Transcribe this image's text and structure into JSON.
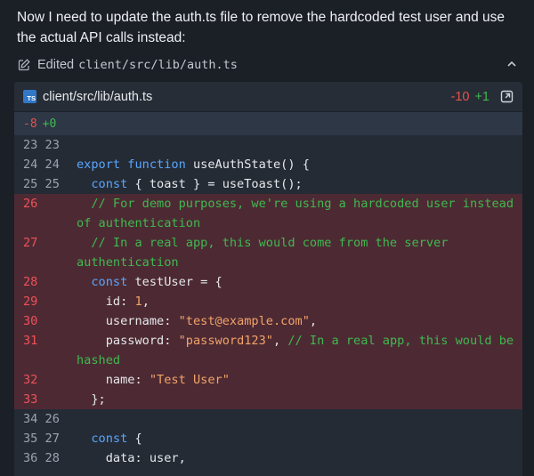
{
  "message": "Now I need to update the auth.ts file to remove the hardcoded test user and use the actual API calls instead:",
  "edited": {
    "label": "Edited",
    "path": "client/src/lib/auth.ts",
    "icon": "edit-icon",
    "collapse_icon": "chevron-up-icon"
  },
  "file": {
    "badge": "TS",
    "name": "client/src/lib/auth.ts",
    "removed": "-10",
    "added": "+1",
    "open_icon": "open-in-editor-icon"
  },
  "hunk": {
    "removed": "-8",
    "added": "+0"
  },
  "lines": [
    {
      "gutter": "23 23",
      "type": "context",
      "tokens": []
    },
    {
      "gutter": "24 24",
      "type": "context",
      "tokens": [
        {
          "t": "kw",
          "v": "export function "
        },
        {
          "t": "fn",
          "v": "useAuthState() {"
        }
      ]
    },
    {
      "gutter": "25 25",
      "type": "context",
      "tokens": [
        {
          "t": "fn",
          "v": "  "
        },
        {
          "t": "kw",
          "v": "const"
        },
        {
          "t": "fn",
          "v": " { toast } = useToast();"
        }
      ]
    },
    {
      "gutter": "26",
      "type": "del",
      "tokens": [
        {
          "t": "cm",
          "v": "  // For demo purposes, we're using a hardcoded user instead of authentication"
        }
      ]
    },
    {
      "gutter": "27",
      "type": "del",
      "tokens": [
        {
          "t": "cm",
          "v": "  // In a real app, this would come from the server authentication"
        }
      ]
    },
    {
      "gutter": "28",
      "type": "del",
      "tokens": [
        {
          "t": "fn",
          "v": "  "
        },
        {
          "t": "kw",
          "v": "const"
        },
        {
          "t": "fn",
          "v": " testUser = {"
        }
      ]
    },
    {
      "gutter": "29",
      "type": "del",
      "tokens": [
        {
          "t": "fn",
          "v": "    id: "
        },
        {
          "t": "num",
          "v": "1"
        },
        {
          "t": "fn",
          "v": ","
        }
      ]
    },
    {
      "gutter": "30",
      "type": "del",
      "tokens": [
        {
          "t": "fn",
          "v": "    username: "
        },
        {
          "t": "str",
          "v": "\"test@example.com\""
        },
        {
          "t": "fn",
          "v": ","
        }
      ]
    },
    {
      "gutter": "31",
      "type": "del",
      "tokens": [
        {
          "t": "fn",
          "v": "    password: "
        },
        {
          "t": "str",
          "v": "\"password123\""
        },
        {
          "t": "fn",
          "v": ", "
        },
        {
          "t": "cm",
          "v": "// In a real app, this would be hashed"
        }
      ]
    },
    {
      "gutter": "32",
      "type": "del",
      "tokens": [
        {
          "t": "fn",
          "v": "    name: "
        },
        {
          "t": "str",
          "v": "\"Test User\""
        }
      ]
    },
    {
      "gutter": "33",
      "type": "del",
      "tokens": [
        {
          "t": "fn",
          "v": "  };"
        }
      ]
    },
    {
      "gutter": "34 26",
      "type": "context",
      "tokens": []
    },
    {
      "gutter": "35 27",
      "type": "context",
      "tokens": [
        {
          "t": "fn",
          "v": "  "
        },
        {
          "t": "kw",
          "v": "const"
        },
        {
          "t": "fn",
          "v": " {"
        }
      ]
    },
    {
      "gutter": "36 28",
      "type": "context",
      "tokens": [
        {
          "t": "fn",
          "v": "    data: user,"
        }
      ]
    }
  ]
}
